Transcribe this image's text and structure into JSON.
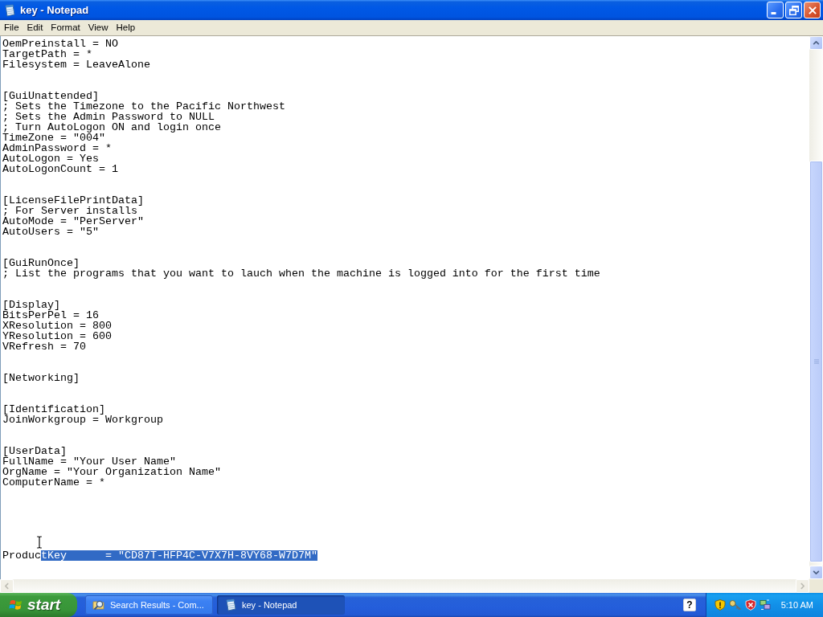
{
  "window": {
    "title": "key - Notepad"
  },
  "menu": [
    "File",
    "Edit",
    "Format",
    "View",
    "Help"
  ],
  "document": {
    "blocks": [
      {
        "lines": [
          "OemPreinstall = NO",
          "TargetPath = *",
          "Filesystem = LeaveAlone"
        ]
      },
      {
        "lines": [
          "[GuiUnattended]",
          "; Sets the Timezone to the Pacific Northwest",
          "; Sets the Admin Password to NULL",
          "; Turn AutoLogon ON and login once",
          "TimeZone = \"004\"",
          "AdminPassword = *",
          "AutoLogon = Yes",
          "AutoLogonCount = 1"
        ]
      },
      {
        "lines": [
          "[LicenseFilePrintData]",
          "; For Server installs",
          "AutoMode = \"PerServer\"",
          "AutoUsers = \"5\""
        ]
      },
      {
        "lines": [
          "[GuiRunOnce]",
          "; List the programs that you want to lauch when the machine is logged into for the first time"
        ]
      },
      {
        "lines": [
          "[Display]",
          "BitsPerPel = 16",
          "XResolution = 800",
          "YResolution = 600",
          "VRefresh = 70"
        ]
      },
      {
        "lines": [
          "[Networking]"
        ]
      },
      {
        "lines": [
          "[Identification]",
          "JoinWorkgroup = Workgroup"
        ]
      },
      {
        "lines": [
          "[UserData]",
          "FullName = \"Your User Name\"",
          "OrgName = \"Your Organization Name\"",
          "ComputerName = *"
        ]
      }
    ],
    "last_line": {
      "segments": [
        {
          "text": "Produc",
          "selected": false
        },
        {
          "text": "tKey      = \"CD87T-HFP4C-V7X7H-8VY68-W7D7M\"",
          "selected": true
        }
      ]
    }
  },
  "taskbar": {
    "start": "start",
    "tasks": [
      {
        "label": "Search Results - Com...",
        "kind": "search",
        "selected": false
      },
      {
        "label": "key - Notepad",
        "kind": "notepad",
        "selected": true
      }
    ],
    "help": "?",
    "clock": "5:10 AM"
  }
}
